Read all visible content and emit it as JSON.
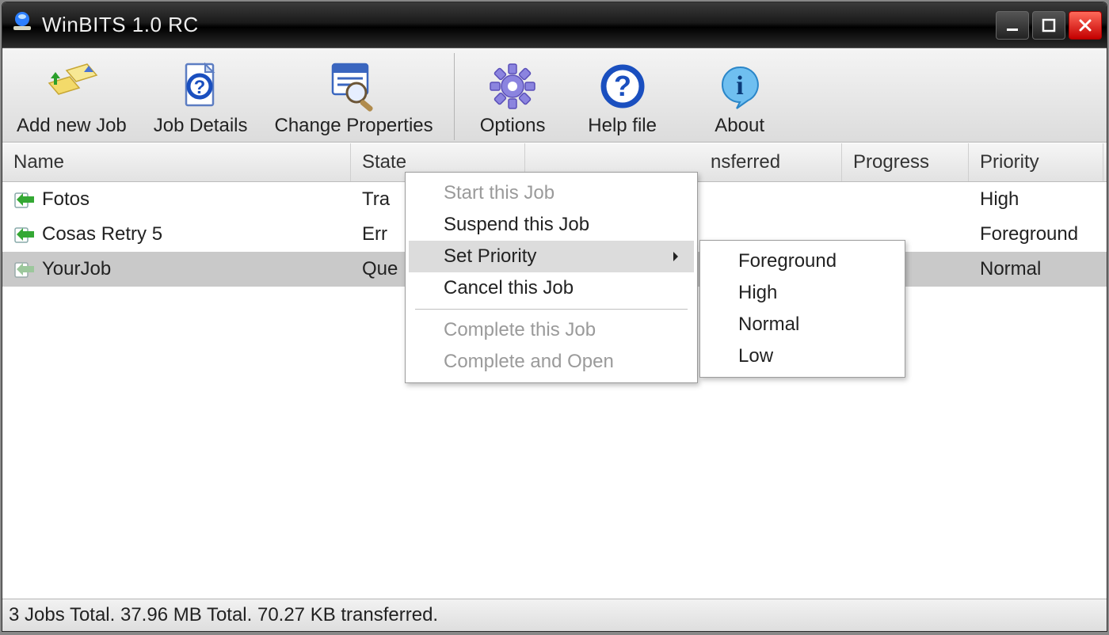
{
  "window": {
    "title": "WinBITS 1.0 RC"
  },
  "toolbar": {
    "add": "Add new Job",
    "details": "Job Details",
    "change": "Change Properties",
    "options": "Options",
    "help": "Help file",
    "about": "About"
  },
  "columns": {
    "name": "Name",
    "state": "State",
    "transferred_hdr_visible": "nsferred",
    "progress": "Progress",
    "priority": "Priority"
  },
  "rows": [
    {
      "name": "Fotos",
      "state_visible": "Tra",
      "priority": "High",
      "selected": false
    },
    {
      "name": "Cosas Retry 5",
      "state_visible": "Err",
      "priority": "Foreground",
      "selected": false
    },
    {
      "name": "YourJob",
      "state_visible": "Que",
      "priority": "Normal",
      "selected": true
    }
  ],
  "context_menu": {
    "start": "Start this Job",
    "suspend": "Suspend this Job",
    "setprio": "Set Priority",
    "cancel": "Cancel this Job",
    "complete": "Complete this Job",
    "compopen": "Complete and Open"
  },
  "priority_menu": {
    "foreground": "Foreground",
    "high": "High",
    "normal": "Normal",
    "low": "Low"
  },
  "status": "3 Jobs Total. 37.96 MB Total. 70.27 KB transferred."
}
